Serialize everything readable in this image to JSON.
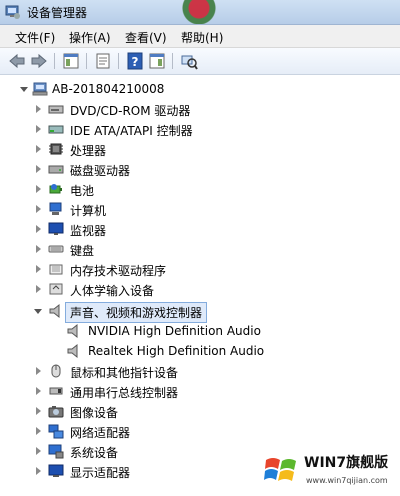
{
  "window": {
    "title": "设备管理器",
    "title_icon": "device-manager-icon"
  },
  "menu": [
    "文件(F)",
    "操作(A)",
    "查看(V)",
    "帮助(H)"
  ],
  "toolbar": {
    "buttons": [
      "back-arrow-icon",
      "forward-arrow-icon",
      "show-hide-tree-icon",
      "properties-icon",
      "help-icon",
      "action-pane-icon",
      "scan-hardware-icon"
    ]
  },
  "tree": {
    "root": {
      "label": "AB-201804210008",
      "icon": "computer-icon"
    },
    "categories": [
      {
        "label": "DVD/CD-ROM 驱动器",
        "icon": "dvd-drive-icon"
      },
      {
        "label": "IDE ATA/ATAPI 控制器",
        "icon": "ide-controller-icon"
      },
      {
        "label": "处理器",
        "icon": "processor-icon"
      },
      {
        "label": "磁盘驱动器",
        "icon": "disk-drive-icon"
      },
      {
        "label": "电池",
        "icon": "battery-icon"
      },
      {
        "label": "计算机",
        "icon": "computer-icon"
      },
      {
        "label": "监视器",
        "icon": "monitor-icon"
      },
      {
        "label": "键盘",
        "icon": "keyboard-icon"
      },
      {
        "label": "内存技术驱动程序",
        "icon": "memory-icon"
      },
      {
        "label": "人体学输入设备",
        "icon": "hid-icon"
      },
      {
        "label": "声音、视频和游戏控制器",
        "icon": "speaker-icon",
        "expanded": true,
        "selected": true,
        "children": [
          {
            "label": "NVIDIA High Definition Audio",
            "icon": "speaker-icon"
          },
          {
            "label": "Realtek High Definition Audio",
            "icon": "speaker-icon"
          }
        ]
      },
      {
        "label": "鼠标和其他指针设备",
        "icon": "mouse-icon"
      },
      {
        "label": "通用串行总线控制器",
        "icon": "usb-icon"
      },
      {
        "label": "图像设备",
        "icon": "camera-icon"
      },
      {
        "label": "网络适配器",
        "icon": "network-adapter-icon"
      },
      {
        "label": "系统设备",
        "icon": "system-device-icon"
      },
      {
        "label": "显示适配器",
        "icon": "display-adapter-icon"
      }
    ]
  },
  "watermark": {
    "brand": "WIN7旗舰版",
    "url": "www.win7qijian.com"
  }
}
